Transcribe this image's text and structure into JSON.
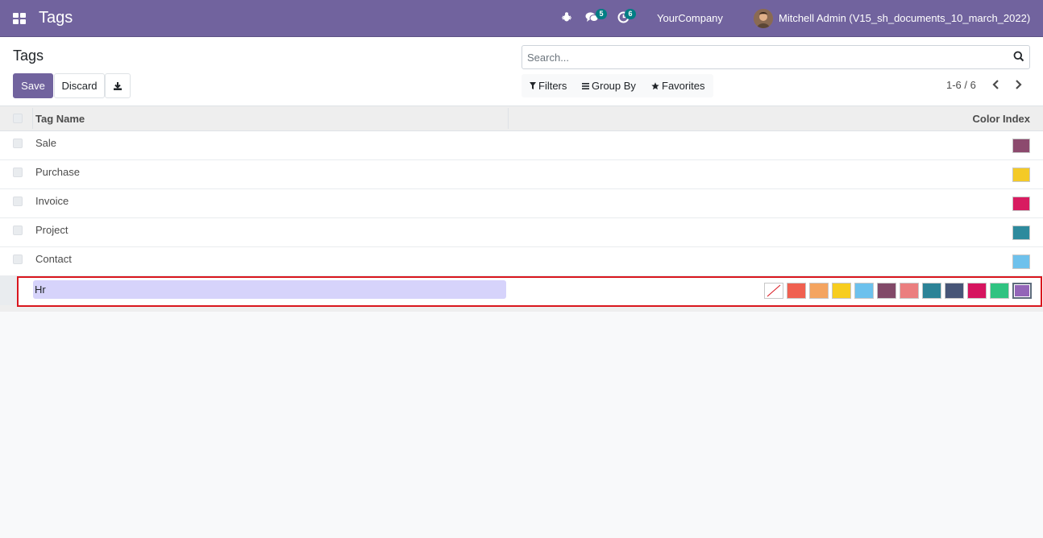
{
  "navbar": {
    "app_title": "Tags",
    "messages_count": "5",
    "activities_count": "6",
    "company": "YourCompany",
    "user": "Mitchell Admin (V15_sh_documents_10_march_2022)"
  },
  "control_panel": {
    "breadcrumb": "Tags",
    "save_label": "Save",
    "discard_label": "Discard",
    "search_placeholder": "Search...",
    "filters_label": "Filters",
    "group_by_label": "Group By",
    "favorites_label": "Favorites",
    "pager_value": "1-6 / 6"
  },
  "table": {
    "columns": {
      "name": "Tag Name",
      "color": "Color Index"
    },
    "rows": [
      {
        "name": "Sale",
        "color": "#8c4a6e"
      },
      {
        "name": "Purchase",
        "color": "#f4ca27"
      },
      {
        "name": "Invoice",
        "color": "#d81b60"
      },
      {
        "name": "Project",
        "color": "#2d8a9d"
      },
      {
        "name": "Contact",
        "color": "#6ec1ec"
      }
    ],
    "editing_row": {
      "value": "Hr",
      "palette": [
        "none",
        "#f06050",
        "#f4a460",
        "#f7cd1f",
        "#6cc1ed",
        "#814968",
        "#eb7e7f",
        "#2c8397",
        "#475577",
        "#d6145f",
        "#30c381",
        "#9365b8"
      ],
      "selected_index": 11
    }
  }
}
